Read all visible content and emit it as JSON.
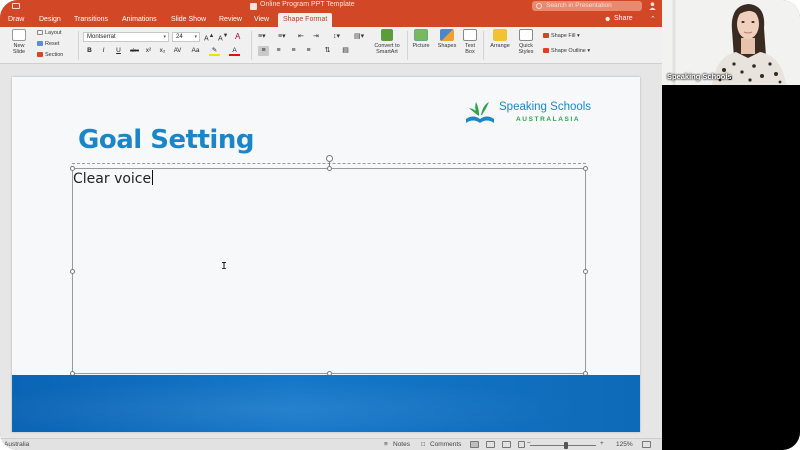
{
  "window": {
    "title": "Online Program PPT Template",
    "search_placeholder": "Search in Presentation"
  },
  "tabs": [
    {
      "label": "Draw"
    },
    {
      "label": "Design"
    },
    {
      "label": "Transitions"
    },
    {
      "label": "Animations"
    },
    {
      "label": "Slide Show"
    },
    {
      "label": "Review"
    },
    {
      "label": "View"
    },
    {
      "label": "Shape Format",
      "active": true
    }
  ],
  "share_label": "Share",
  "ribbon": {
    "new_slide": "New\nSlide",
    "layout": "Layout",
    "reset": "Reset",
    "section": "Section",
    "font_name": "Montserrat",
    "font_size": "24",
    "bold": "B",
    "italic": "I",
    "underline": "U",
    "strike": "abc",
    "superscript": "x²",
    "subscript": "x₂",
    "convert_smartart": "Convert to\nSmartArt",
    "picture": "Picture",
    "shapes": "Shapes",
    "text_box": "Text\nBox",
    "arrange": "Arrange",
    "quick_styles": "Quick\nStyles",
    "shape_fill": "Shape Fill",
    "shape_outline": "Shape Outline"
  },
  "slide": {
    "title": "Goal Setting",
    "textbox_text": "Clear voice",
    "logo_name": "Speaking Schools",
    "logo_sub": "AUSTRALASIA"
  },
  "status": {
    "language": "Australia",
    "notes": "Notes",
    "comments": "Comments",
    "zoom": "125%",
    "zoom_fraction": 0.55
  },
  "webcam": {
    "name": "Speaking Schools"
  },
  "colors": {
    "accent": "#d24726",
    "title_blue": "#1a86c8",
    "band_blue": "#0d6ab8",
    "logo_green": "#2aa34a"
  }
}
